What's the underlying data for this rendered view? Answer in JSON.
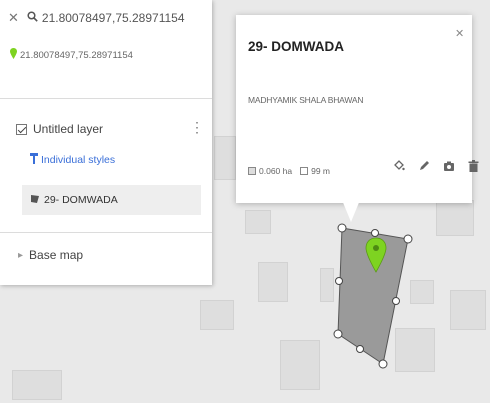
{
  "search": {
    "query": "21.80078497,75.28971154",
    "result_label": "21.80078497,75.28971154"
  },
  "layer": {
    "name": "Untitled layer",
    "styles_label": "Individual styles",
    "feature_label": "29- DOMWADA"
  },
  "basemap": {
    "label": "Base map"
  },
  "popup": {
    "title": "29- DOMWADA",
    "description": "MADHYAMIK SHALA BHAWAN",
    "area": "0.060 ha",
    "perimeter": "99 m"
  },
  "colors": {
    "pin_green": "#7ed321",
    "link_blue": "#3a6fd8",
    "polygon_fill": "#8c8c8c"
  },
  "icons": [
    "close-icon",
    "search-icon",
    "map-pin-icon",
    "checkbox-icon",
    "more-vert-icon",
    "paint-bucket-icon",
    "pencil-icon",
    "camera-icon",
    "trash-icon"
  ]
}
